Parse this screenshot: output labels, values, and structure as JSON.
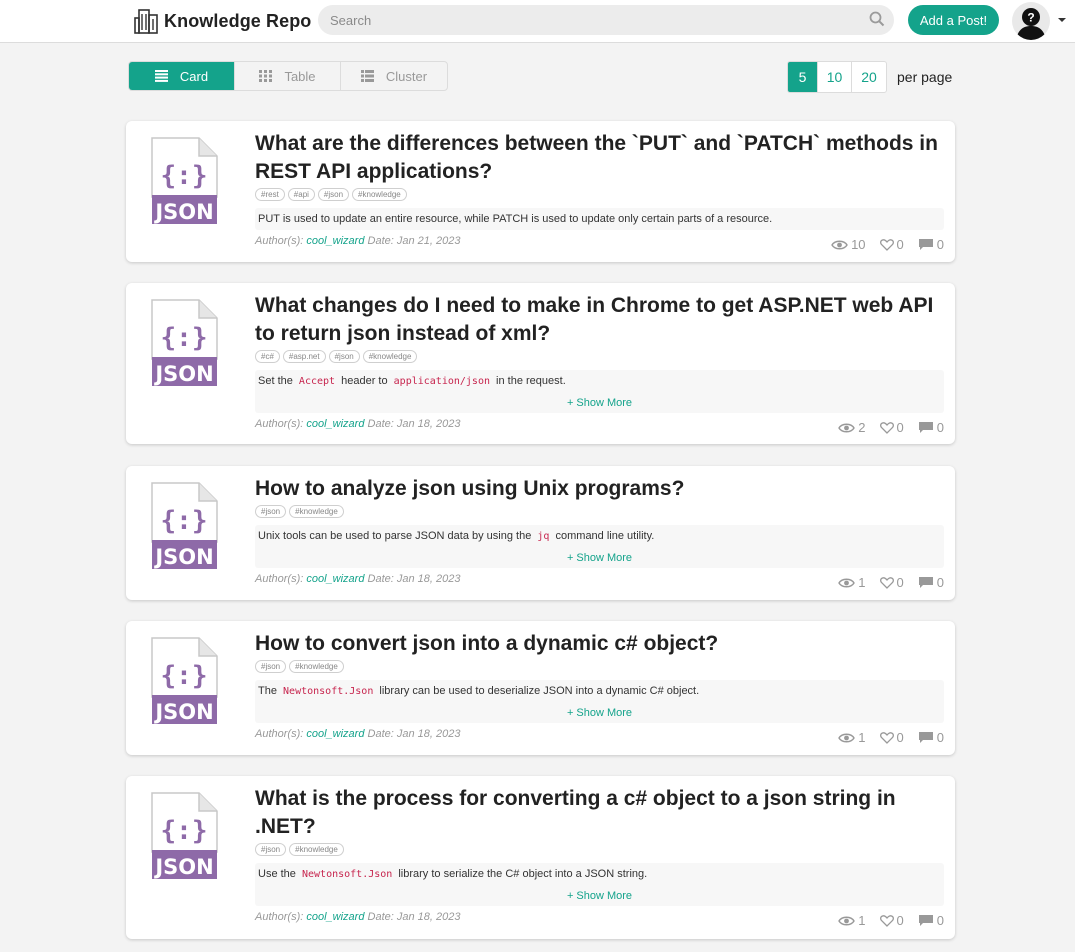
{
  "header": {
    "brand": "Knowledge Repo",
    "search_placeholder": "Search",
    "add_post_label": "Add a Post!"
  },
  "view_toggle": {
    "options": [
      {
        "label": "Card",
        "icon": "card-list-icon",
        "active": true
      },
      {
        "label": "Table",
        "icon": "grid-icon",
        "active": false
      },
      {
        "label": "Cluster",
        "icon": "list-icon",
        "active": false
      }
    ]
  },
  "per_page": {
    "options": [
      "5",
      "10",
      "20"
    ],
    "selected": "5",
    "label": "per page"
  },
  "posts": [
    {
      "title": "What are the differences between the `PUT` and `PATCH` methods in REST API applications?",
      "tags": [
        "#rest",
        "#api",
        "#json",
        "#knowledge"
      ],
      "summary_parts": [
        {
          "text": "PUT is used to update an entire resource, while PATCH is used to update only certain parts of a resource.",
          "code": false
        }
      ],
      "show_more": "",
      "author_label": "Author(s):",
      "author": "cool_wizard",
      "date": "Date: Jan 21, 2023",
      "views": "10",
      "likes": "0",
      "comments": "0"
    },
    {
      "title": "What changes do I need to make in Chrome to get ASP.NET web API to return json instead of xml?",
      "tags": [
        "#c#",
        "#asp.net",
        "#json",
        "#knowledge"
      ],
      "summary_parts": [
        {
          "text": "Set the",
          "code": false
        },
        {
          "text": "Accept",
          "code": true
        },
        {
          "text": "header to",
          "code": false
        },
        {
          "text": "application/json",
          "code": true
        },
        {
          "text": "in the request.",
          "code": false
        }
      ],
      "show_more": "+ Show More",
      "author_label": "Author(s):",
      "author": "cool_wizard",
      "date": "Date: Jan 18, 2023",
      "views": "2",
      "likes": "0",
      "comments": "0"
    },
    {
      "title": "How to analyze json using Unix programs?",
      "tags": [
        "#json",
        "#knowledge"
      ],
      "summary_parts": [
        {
          "text": "Unix tools can be used to parse JSON data by using the",
          "code": false
        },
        {
          "text": "jq",
          "code": true
        },
        {
          "text": "command line utility.",
          "code": false
        }
      ],
      "show_more": "+ Show More",
      "author_label": "Author(s):",
      "author": "cool_wizard",
      "date": "Date: Jan 18, 2023",
      "views": "1",
      "likes": "0",
      "comments": "0"
    },
    {
      "title": "How to convert json into a dynamic c# object?",
      "tags": [
        "#json",
        "#knowledge"
      ],
      "summary_parts": [
        {
          "text": "The",
          "code": false
        },
        {
          "text": "Newtonsoft.Json",
          "code": true
        },
        {
          "text": "library can be used to deserialize JSON into a dynamic C# object.",
          "code": false
        }
      ],
      "show_more": "+ Show More",
      "author_label": "Author(s):",
      "author": "cool_wizard",
      "date": "Date: Jan 18, 2023",
      "views": "1",
      "likes": "0",
      "comments": "0"
    },
    {
      "title": "What is the process for converting a c# object to a json string in .NET?",
      "tags": [
        "#json",
        "#knowledge"
      ],
      "summary_parts": [
        {
          "text": "Use the",
          "code": false
        },
        {
          "text": "Newtonsoft.Json",
          "code": true
        },
        {
          "text": "library to serialize the C# object into a JSON string.",
          "code": false
        }
      ],
      "show_more": "+ Show More",
      "author_label": "Author(s):",
      "author": "cool_wizard",
      "date": "Date: Jan 18, 2023",
      "views": "1",
      "likes": "0",
      "comments": "0"
    }
  ],
  "colors": {
    "accent": "#14a38b",
    "json_icon_purple": "#8e6aa8",
    "code_text": "#c7254e"
  }
}
